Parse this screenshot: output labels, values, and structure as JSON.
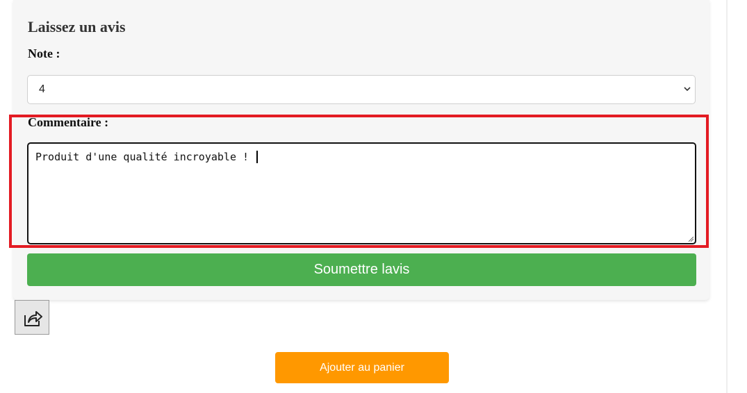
{
  "review_form": {
    "heading": "Laissez un avis",
    "rating_label": "Note :",
    "rating_selected": "4",
    "comment_label": "Commentaire :",
    "comment_value": "Produit d'une qualité incroyable ! ",
    "submit_label": "Soumettre lavis"
  },
  "share": {
    "icon": "share-icon"
  },
  "cart": {
    "add_label": "Ajouter au panier"
  },
  "colors": {
    "submit_bg": "#4caf50",
    "cart_bg": "#ff9800",
    "highlight": "#e31b23",
    "card_bg": "#f6f6f6"
  }
}
